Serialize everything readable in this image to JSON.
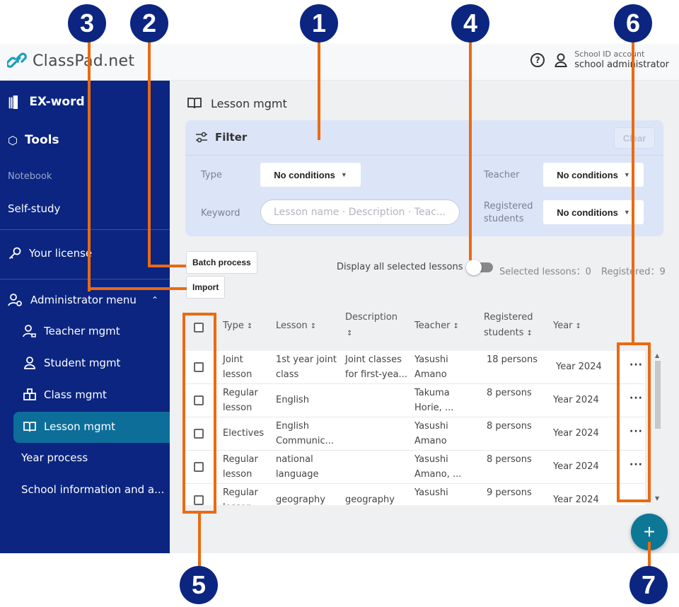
{
  "app": {
    "logo_text": "ClassPad.net",
    "user": {
      "account_type": "School ID account",
      "role": "school administrator"
    }
  },
  "sidebar": {
    "items": [
      {
        "label": "EX-word",
        "icon": "books-icon"
      },
      {
        "label": "Tools",
        "icon": "toolbox-icon"
      },
      {
        "label": "Notebook"
      },
      {
        "label": "Self-study"
      },
      {
        "label": "Your license",
        "icon": "key-icon"
      },
      {
        "label": "Administrator menu",
        "icon": "admin-icon",
        "expanded": true
      }
    ],
    "admin_items": [
      {
        "label": "Teacher mgmt",
        "icon": "teacher-icon"
      },
      {
        "label": "Student mgmt",
        "icon": "person-icon"
      },
      {
        "label": "Class mgmt",
        "icon": "class-icon"
      },
      {
        "label": "Lesson mgmt",
        "icon": "book-icon",
        "active": true
      },
      {
        "label": "Year process"
      },
      {
        "label": "School information and a..."
      }
    ]
  },
  "main": {
    "page_title": "Lesson mgmt",
    "filter": {
      "title": "Filter",
      "clear_label": "Clear",
      "type_label": "Type",
      "type_value": "No conditions",
      "keyword_label": "Keyword",
      "keyword_placeholder": "Lesson name · Description · Teac...",
      "teacher_label": "Teacher",
      "teacher_value": "No conditions",
      "registered_label_1": "Registered",
      "registered_label_2": "students",
      "registered_value": "No conditions"
    },
    "batch_process_label": "Batch process",
    "import_label": "Import",
    "toggle_label": "Display all selected lessons",
    "toggle_on": false,
    "selected_lessons": "Selected lessons：0",
    "registered_count": "Registered：9",
    "table": {
      "headers": [
        "Type",
        "Lesson",
        "Description",
        "Teacher",
        "Registered",
        "students",
        "Year"
      ],
      "rows": [
        {
          "type": [
            "Joint",
            "lesson"
          ],
          "lesson": [
            "1st year joint",
            "class"
          ],
          "description": [
            "Joint classes",
            "for first-yea..."
          ],
          "teacher": [
            "Yasushi",
            "Amano"
          ],
          "registered": "18 persons",
          "year": "Year 2024"
        },
        {
          "type": [
            "Regular",
            "lesson"
          ],
          "lesson": [
            "English",
            ""
          ],
          "description": [
            "",
            ""
          ],
          "teacher": [
            "Takuma",
            "Horie, ..."
          ],
          "registered": "8 persons",
          "year": "Year 2024"
        },
        {
          "type": [
            "Electives",
            ""
          ],
          "lesson": [
            "English",
            "Communic..."
          ],
          "description": [
            "",
            ""
          ],
          "teacher": [
            "Yasushi",
            "Amano"
          ],
          "registered": "8 persons",
          "year": "Year 2024"
        },
        {
          "type": [
            "Regular",
            "lesson"
          ],
          "lesson": [
            "national",
            "language"
          ],
          "description": [
            "",
            ""
          ],
          "teacher": [
            "Yasushi",
            "Amano, ..."
          ],
          "registered": "8 persons",
          "year": "Year 2024"
        },
        {
          "type": [
            "Regular",
            "lesson"
          ],
          "lesson": [
            "geography",
            ""
          ],
          "description": [
            "geography",
            ""
          ],
          "teacher": [
            "Yasushi",
            ""
          ],
          "registered": "9 persons",
          "year": "Year 2024"
        }
      ],
      "more_label": "···"
    },
    "fab_label": "+"
  },
  "annotations": [
    "1",
    "2",
    "3",
    "4",
    "5",
    "6",
    "7"
  ],
  "colors": {
    "sidebar": "#0b2580",
    "active": "#0d6e9a",
    "accent": "#ea6a12",
    "fab": "#0d7796"
  }
}
